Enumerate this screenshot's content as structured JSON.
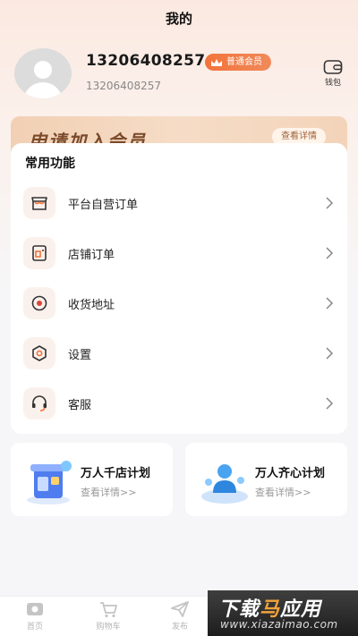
{
  "header": {
    "title": "我的"
  },
  "profile": {
    "phone": "13206408257",
    "sub_phone": "13206408257",
    "badge": "普通会员",
    "wallet_label": "钱包"
  },
  "member_banner": {
    "title": "申请加入会员",
    "button": "查看详情"
  },
  "functions": {
    "title": "常用功能",
    "items": [
      {
        "label": "平台自营订单",
        "icon": "shop-order-icon"
      },
      {
        "label": "店铺订单",
        "icon": "store-order-icon"
      },
      {
        "label": "收货地址",
        "icon": "location-icon"
      },
      {
        "label": "设置",
        "icon": "settings-icon"
      },
      {
        "label": "客服",
        "icon": "headset-icon"
      }
    ]
  },
  "plans": [
    {
      "title": "万人千店计划",
      "link": "查看详情>>"
    },
    {
      "title": "万人齐心计划",
      "link": "查看详情>>"
    }
  ],
  "tabbar": {
    "items": [
      {
        "label": "首页"
      },
      {
        "label": "购物车"
      },
      {
        "label": "发布"
      }
    ]
  },
  "watermark": {
    "main_a": "下载",
    "main_b": "马",
    "main_c": "应用",
    "sub": "www.xiazaimao.com"
  },
  "colors": {
    "accent": "#f2733b",
    "icon_bg": "#fbf1ec"
  }
}
